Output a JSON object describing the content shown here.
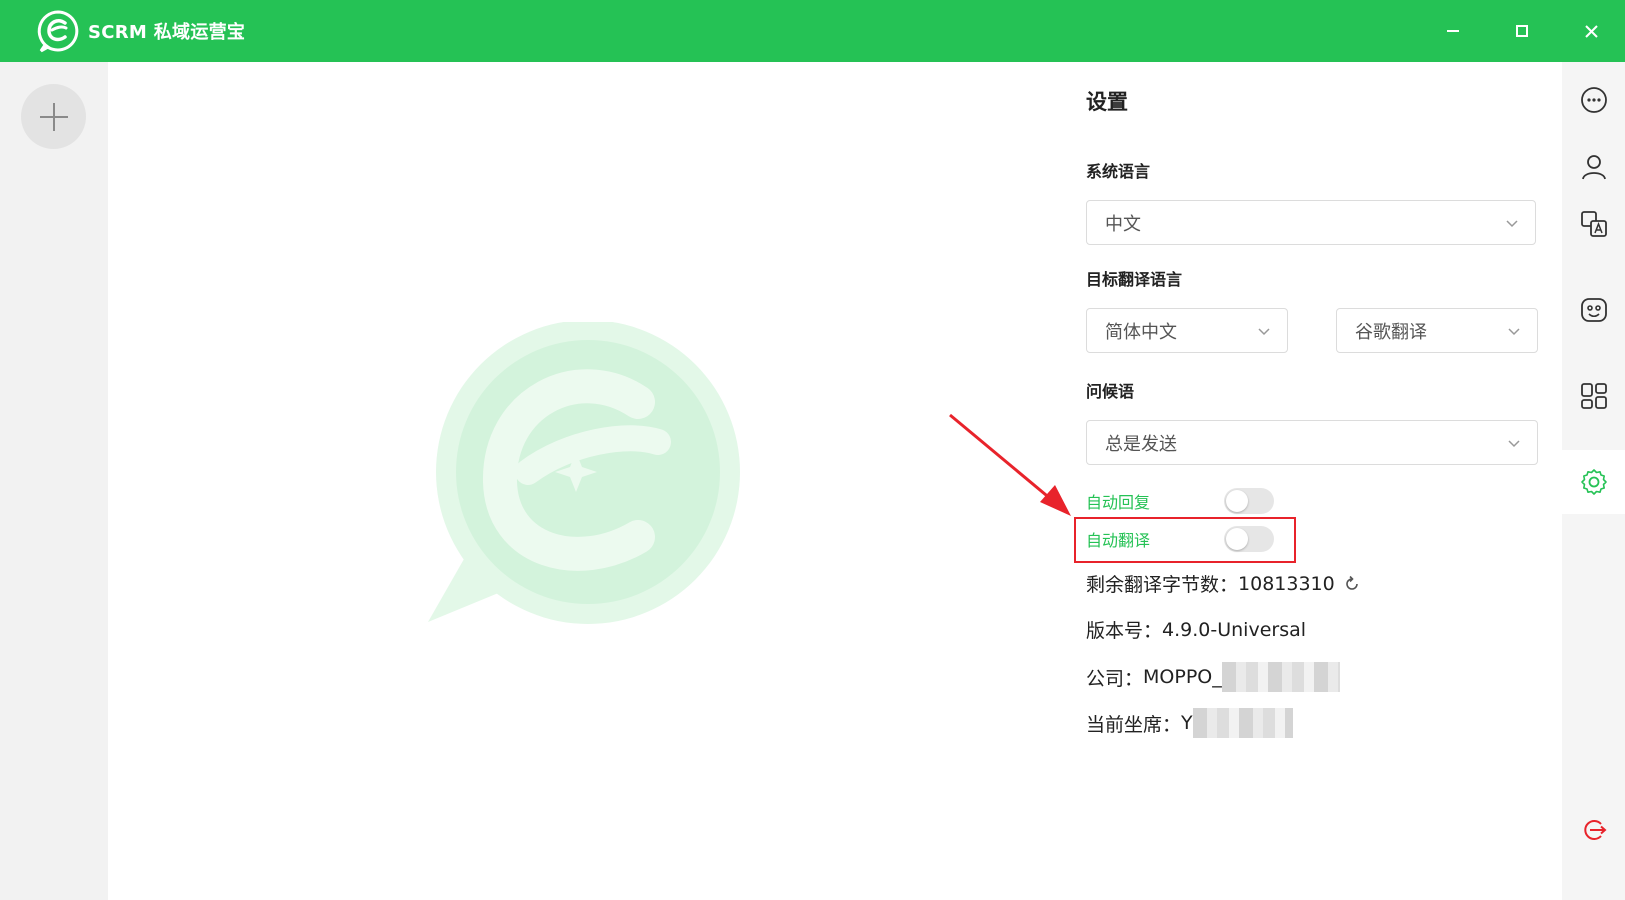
{
  "app": {
    "title": "SCRM 私域运营宝"
  },
  "colors": {
    "brand": "#25c255",
    "highlight": "#e8232b",
    "arrow": "#e8232b"
  },
  "settings": {
    "title": "设置",
    "system_language": {
      "label": "系统语言",
      "value": "中文"
    },
    "target_translation": {
      "label": "目标翻译语言",
      "language_value": "简体中文",
      "engine_value": "谷歌翻译"
    },
    "greeting": {
      "label": "问候语",
      "value": "总是发送"
    },
    "auto_reply": {
      "label": "自动回复",
      "enabled": false
    },
    "auto_translate": {
      "label": "自动翻译",
      "enabled": false
    },
    "remaining_chars": {
      "label": "剩余翻译字节数：",
      "value": "10813310"
    },
    "version": {
      "label": "版本号：",
      "value": "4.9.0-Universal"
    },
    "company": {
      "label": "公司：",
      "value": "MOPPO_"
    },
    "current_seat": {
      "label": "当前坐席：",
      "value": "Y"
    }
  },
  "right_toolbar": {
    "items": [
      {
        "icon": "more-chat-icon"
      },
      {
        "icon": "user-icon"
      },
      {
        "icon": "translate-icon"
      },
      {
        "icon": "brain-icon"
      },
      {
        "icon": "apps-icon"
      },
      {
        "icon": "gear-icon",
        "active": true
      },
      {
        "icon": "logout-icon"
      }
    ]
  }
}
